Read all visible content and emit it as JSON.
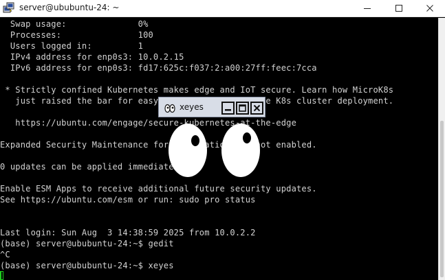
{
  "window": {
    "title": "server@ububuntu-24: ~",
    "icon": "putty-icon"
  },
  "terminal": {
    "lines": [
      "  Swap usage:              0%",
      "  Processes:               100",
      "  Users logged in:         1",
      "  IPv4 address for enp0s3: 10.0.2.15",
      "  IPv6 address for enp0s3: fd17:625c:f037:2:a00:27ff:feec:7cca",
      "",
      " * Strictly confined Kubernetes makes edge and IoT secure. Learn how MicroK8s",
      "   just raised the bar for easy, resilient and secure K8s cluster deployment.",
      "",
      "   https://ubuntu.com/engage/secure-kubernetes-at-the-edge",
      "",
      "Expanded Security Maintenance for Applications is not enabled.",
      "",
      "0 updates can be applied immediately.",
      "",
      "Enable ESM Apps to receive additional future security updates.",
      "See https://ubuntu.com/esm or run: sudo pro status",
      "",
      "",
      "Last login: Sun Aug  3 14:38:59 2025 from 10.0.2.2",
      "(base) server@ububuntu-24:~$ gedit",
      "^C",
      "(base) server@ububuntu-24:~$ xeyes"
    ],
    "text_color": "#d2d2d2",
    "cursor_color": "#1ed01e"
  },
  "xeyes": {
    "title": "xeyes",
    "icon": "xeyes-icon",
    "titlebar_color": "#d8dde7"
  }
}
